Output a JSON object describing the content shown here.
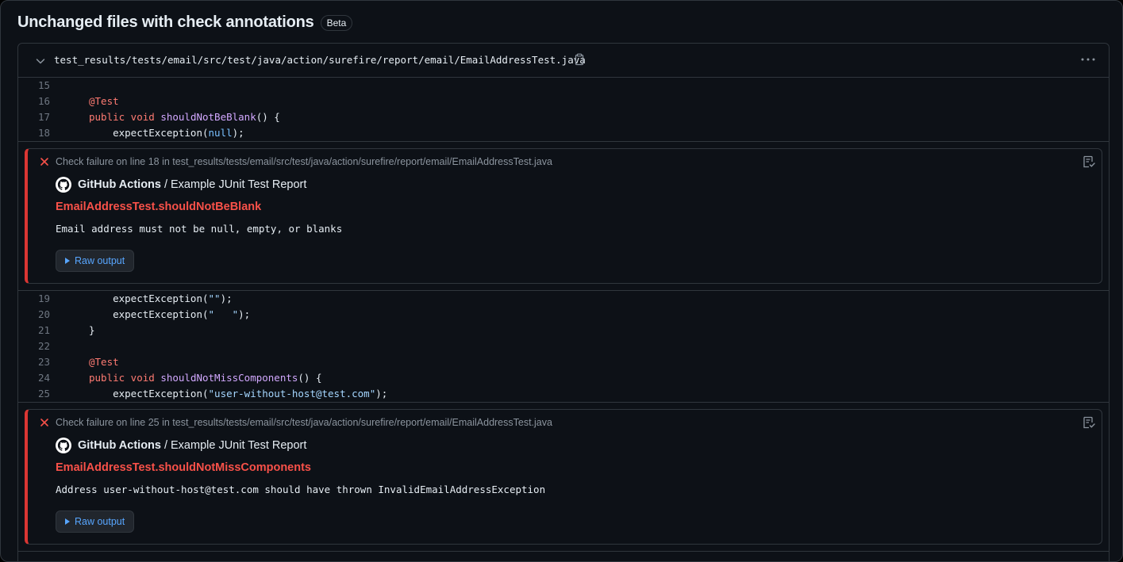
{
  "heading": {
    "title": "Unchanged files with check annotations",
    "badge": "Beta"
  },
  "file": {
    "path": "test_results/tests/email/src/test/java/action/surefire/report/email/EmailAddressTest.java"
  },
  "code_blocks": [
    {
      "lines": [
        {
          "num": "15",
          "code": ""
        },
        {
          "num": "16",
          "code": "@Test"
        },
        {
          "num": "17",
          "code": "public void shouldNotBeBlank() {"
        },
        {
          "num": "18",
          "code": "    expectException(null);"
        }
      ]
    },
    {
      "lines": [
        {
          "num": "19",
          "code": "    expectException(\"\");"
        },
        {
          "num": "20",
          "code": "    expectException(\"   \");"
        },
        {
          "num": "21",
          "code": "}"
        },
        {
          "num": "22",
          "code": ""
        },
        {
          "num": "23",
          "code": "@Test"
        },
        {
          "num": "24",
          "code": "public void shouldNotMissComponents() {"
        },
        {
          "num": "25",
          "code": "    expectException(\"user-without-host@test.com\");"
        }
      ]
    }
  ],
  "annotations": [
    {
      "location": "Check failure on line 18 in test_results/tests/email/src/test/java/action/surefire/report/email/EmailAddressTest.java",
      "source_app": "GitHub Actions",
      "source_separator": "/",
      "source_name": "Example JUnit Test Report",
      "title": "EmailAddressTest.shouldNotBeBlank",
      "message": "Email address must not be null, empty, or blanks",
      "raw_output_label": "Raw output"
    },
    {
      "location": "Check failure on line 25 in test_results/tests/email/src/test/java/action/surefire/report/email/EmailAddressTest.java",
      "source_app": "GitHub Actions",
      "source_separator": "/",
      "source_name": "Example JUnit Test Report",
      "title": "EmailAddressTest.shouldNotMissComponents",
      "message": "Address user-without-host@test.com should have thrown InvalidEmailAddressException",
      "raw_output_label": "Raw output"
    }
  ],
  "colors": {
    "background": "#0d1117",
    "border": "#30363d",
    "failure": "#f85149",
    "keyword": "#ff7b72",
    "function": "#d2a8ff",
    "literal": "#79c0ff",
    "link": "#58a6ff"
  },
  "icons": {
    "chevron": "chevron-down-icon",
    "copy": "copy-icon",
    "more": "kebab-horizontal-icon",
    "failure": "x-icon",
    "annotation_action": "checklist-icon",
    "source_logo": "github-mark-icon",
    "raw_output": "triangle-right-icon"
  }
}
